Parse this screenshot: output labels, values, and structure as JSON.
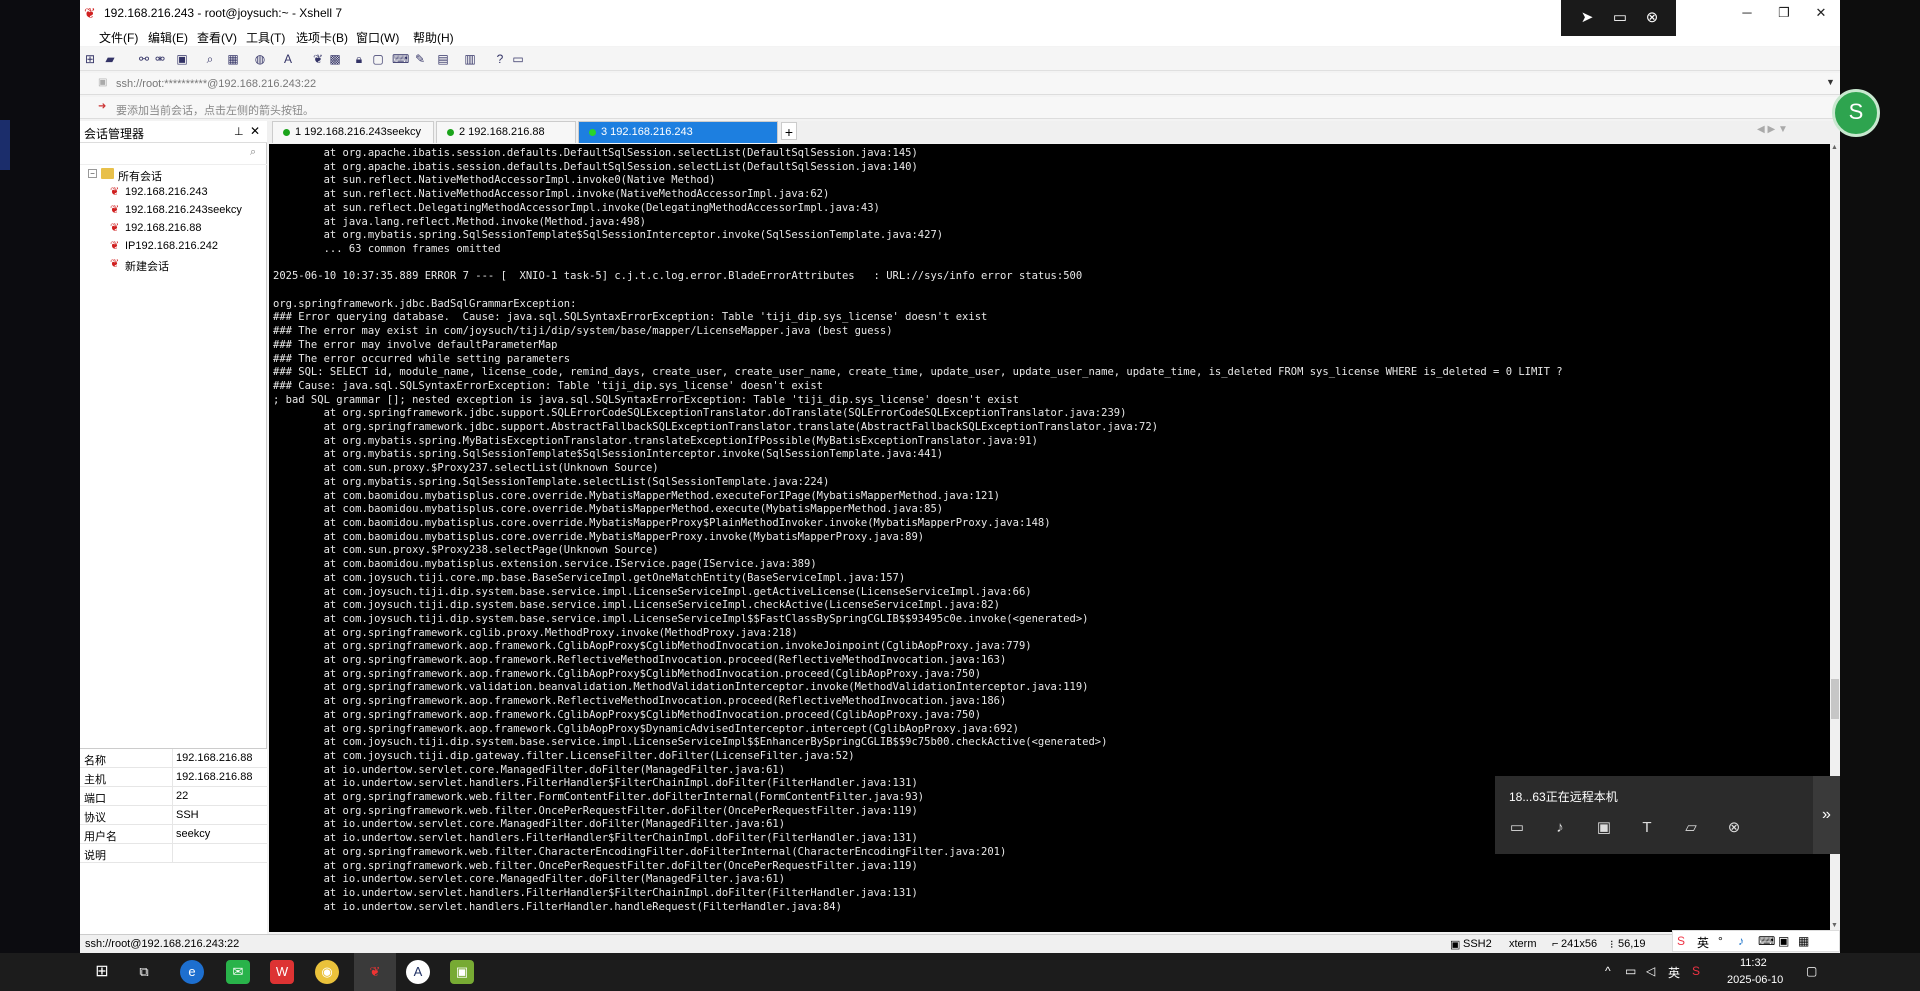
{
  "window": {
    "title": "192.168.216.243 - root@joysuch:~ - Xshell 7",
    "min": "─",
    "max": "❐",
    "close": "✕"
  },
  "remote_float": {
    "icons": [
      "send-icon",
      "screen-icon",
      "close-icon"
    ]
  },
  "menu": [
    "文件(F)",
    "编辑(E)",
    "查看(V)",
    "工具(T)",
    "选项卡(B)",
    "窗口(W)",
    "帮助(H)"
  ],
  "address": {
    "value": "ssh://root:**********@192.168.216.243:22"
  },
  "hint": {
    "text": "要添加当前会话，点击左侧的箭头按钮。"
  },
  "session_manager": {
    "title": "会话管理器",
    "root": "所有会话",
    "items": [
      "192.168.216.243",
      "192.168.216.243seekcy",
      "192.168.216.88",
      "IP192.168.216.242",
      "新建会话"
    ],
    "props": [
      {
        "k": "名称",
        "v": "192.168.216.88"
      },
      {
        "k": "主机",
        "v": "192.168.216.88"
      },
      {
        "k": "端口",
        "v": "22"
      },
      {
        "k": "协议",
        "v": "SSH"
      },
      {
        "k": "用户名",
        "v": "seekcy"
      },
      {
        "k": "说明",
        "v": ""
      }
    ]
  },
  "tabs": [
    {
      "label": "1 192.168.216.243seekcy",
      "active": false
    },
    {
      "label": "2 192.168.216.88",
      "active": false
    },
    {
      "label": "3 192.168.216.243",
      "active": true
    }
  ],
  "terminal": {
    "lines": [
      "        at org.apache.ibatis.session.defaults.DefaultSqlSession.selectList(DefaultSqlSession.java:145)",
      "        at org.apache.ibatis.session.defaults.DefaultSqlSession.selectList(DefaultSqlSession.java:140)",
      "        at sun.reflect.NativeMethodAccessorImpl.invoke0(Native Method)",
      "        at sun.reflect.NativeMethodAccessorImpl.invoke(NativeMethodAccessorImpl.java:62)",
      "        at sun.reflect.DelegatingMethodAccessorImpl.invoke(DelegatingMethodAccessorImpl.java:43)",
      "        at java.lang.reflect.Method.invoke(Method.java:498)",
      "        at org.mybatis.spring.SqlSessionTemplate$SqlSessionInterceptor.invoke(SqlSessionTemplate.java:427)",
      "        ... 63 common frames omitted",
      "",
      "2025-06-10 10:37:35.889 ERROR 7 --- [  XNIO-1 task-5] c.j.t.c.log.error.BladeErrorAttributes   : URL://sys/info error status:500",
      "",
      "org.springframework.jdbc.BadSqlGrammarException:",
      "### Error querying database.  Cause: java.sql.SQLSyntaxErrorException: Table 'tiji_dip.sys_license' doesn't exist",
      "### The error may exist in com/joysuch/tiji/dip/system/base/mapper/LicenseMapper.java (best guess)",
      "### The error may involve defaultParameterMap",
      "### The error occurred while setting parameters",
      "### SQL: SELECT id, module_name, license_code, remind_days, create_user, create_user_name, create_time, update_user, update_user_name, update_time, is_deleted FROM sys_license WHERE is_deleted = 0 LIMIT ?",
      "### Cause: java.sql.SQLSyntaxErrorException: Table 'tiji_dip.sys_license' doesn't exist",
      "; bad SQL grammar []; nested exception is java.sql.SQLSyntaxErrorException: Table 'tiji_dip.sys_license' doesn't exist",
      "        at org.springframework.jdbc.support.SQLErrorCodeSQLExceptionTranslator.doTranslate(SQLErrorCodeSQLExceptionTranslator.java:239)",
      "        at org.springframework.jdbc.support.AbstractFallbackSQLExceptionTranslator.translate(AbstractFallbackSQLExceptionTranslator.java:72)",
      "        at org.mybatis.spring.MyBatisExceptionTranslator.translateExceptionIfPossible(MyBatisExceptionTranslator.java:91)",
      "        at org.mybatis.spring.SqlSessionTemplate$SqlSessionInterceptor.invoke(SqlSessionTemplate.java:441)",
      "        at com.sun.proxy.$Proxy237.selectList(Unknown Source)",
      "        at org.mybatis.spring.SqlSessionTemplate.selectList(SqlSessionTemplate.java:224)",
      "        at com.baomidou.mybatisplus.core.override.MybatisMapperMethod.executeForIPage(MybatisMapperMethod.java:121)",
      "        at com.baomidou.mybatisplus.core.override.MybatisMapperMethod.execute(MybatisMapperMethod.java:85)",
      "        at com.baomidou.mybatisplus.core.override.MybatisMapperProxy$PlainMethodInvoker.invoke(MybatisMapperProxy.java:148)",
      "        at com.baomidou.mybatisplus.core.override.MybatisMapperProxy.invoke(MybatisMapperProxy.java:89)",
      "        at com.sun.proxy.$Proxy238.selectPage(Unknown Source)",
      "        at com.baomidou.mybatisplus.extension.service.IService.page(IService.java:389)",
      "        at com.joysuch.tiji.core.mp.base.BaseServiceImpl.getOneMatchEntity(BaseServiceImpl.java:157)",
      "        at com.joysuch.tiji.dip.system.base.service.impl.LicenseServiceImpl.getActiveLicense(LicenseServiceImpl.java:66)",
      "        at com.joysuch.tiji.dip.system.base.service.impl.LicenseServiceImpl.checkActive(LicenseServiceImpl.java:82)",
      "        at com.joysuch.tiji.dip.system.base.service.impl.LicenseServiceImpl$$FastClassBySpringCGLIB$$93495c0e.invoke(<generated>)",
      "        at org.springframework.cglib.proxy.MethodProxy.invoke(MethodProxy.java:218)",
      "        at org.springframework.aop.framework.CglibAopProxy$CglibMethodInvocation.invokeJoinpoint(CglibAopProxy.java:779)",
      "        at org.springframework.aop.framework.ReflectiveMethodInvocation.proceed(ReflectiveMethodInvocation.java:163)",
      "        at org.springframework.aop.framework.CglibAopProxy$CglibMethodInvocation.proceed(CglibAopProxy.java:750)",
      "        at org.springframework.validation.beanvalidation.MethodValidationInterceptor.invoke(MethodValidationInterceptor.java:119)",
      "        at org.springframework.aop.framework.ReflectiveMethodInvocation.proceed(ReflectiveMethodInvocation.java:186)",
      "        at org.springframework.aop.framework.CglibAopProxy$CglibMethodInvocation.proceed(CglibAopProxy.java:750)",
      "        at org.springframework.aop.framework.CglibAopProxy$DynamicAdvisedInterceptor.intercept(CglibAopProxy.java:692)",
      "        at com.joysuch.tiji.dip.system.base.service.impl.LicenseServiceImpl$$EnhancerBySpringCGLIB$$9c75b00.checkActive(<generated>)",
      "        at com.joysuch.tiji.dip.gateway.filter.LicenseFilter.doFilter(LicenseFilter.java:52)",
      "        at io.undertow.servlet.core.ManagedFilter.doFilter(ManagedFilter.java:61)",
      "        at io.undertow.servlet.handlers.FilterHandler$FilterChainImpl.doFilter(FilterHandler.java:131)",
      "        at org.springframework.web.filter.FormContentFilter.doFilterInternal(FormContentFilter.java:93)",
      "        at org.springframework.web.filter.OncePerRequestFilter.doFilter(OncePerRequestFilter.java:119)",
      "        at io.undertow.servlet.core.ManagedFilter.doFilter(ManagedFilter.java:61)",
      "        at io.undertow.servlet.handlers.FilterHandler$FilterChainImpl.doFilter(FilterHandler.java:131)",
      "        at org.springframework.web.filter.CharacterEncodingFilter.doFilterInternal(CharacterEncodingFilter.java:201)",
      "        at org.springframework.web.filter.OncePerRequestFilter.doFilter(OncePerRequestFilter.java:119)",
      "        at io.undertow.servlet.core.ManagedFilter.doFilter(ManagedFilter.java:61)",
      "        at io.undertow.servlet.handlers.FilterHandler$FilterChainImpl.doFilter(FilterHandler.java:131)",
      "        at io.undertow.servlet.handlers.FilterHandler.handleRequest(FilterHandler.java:84)"
    ]
  },
  "statusbar": {
    "connection": "ssh://root@192.168.216.243:22",
    "protocol": "SSH2",
    "term": "xterm",
    "size": "241x56",
    "cursor": "56,19"
  },
  "remote_panel": {
    "message": "18...63正在远程本机",
    "collapse": "»"
  },
  "ime": {
    "lang": "英"
  },
  "taskbar": {
    "tray_lang": "英",
    "time": "11:32",
    "date": "2025-06-10"
  }
}
